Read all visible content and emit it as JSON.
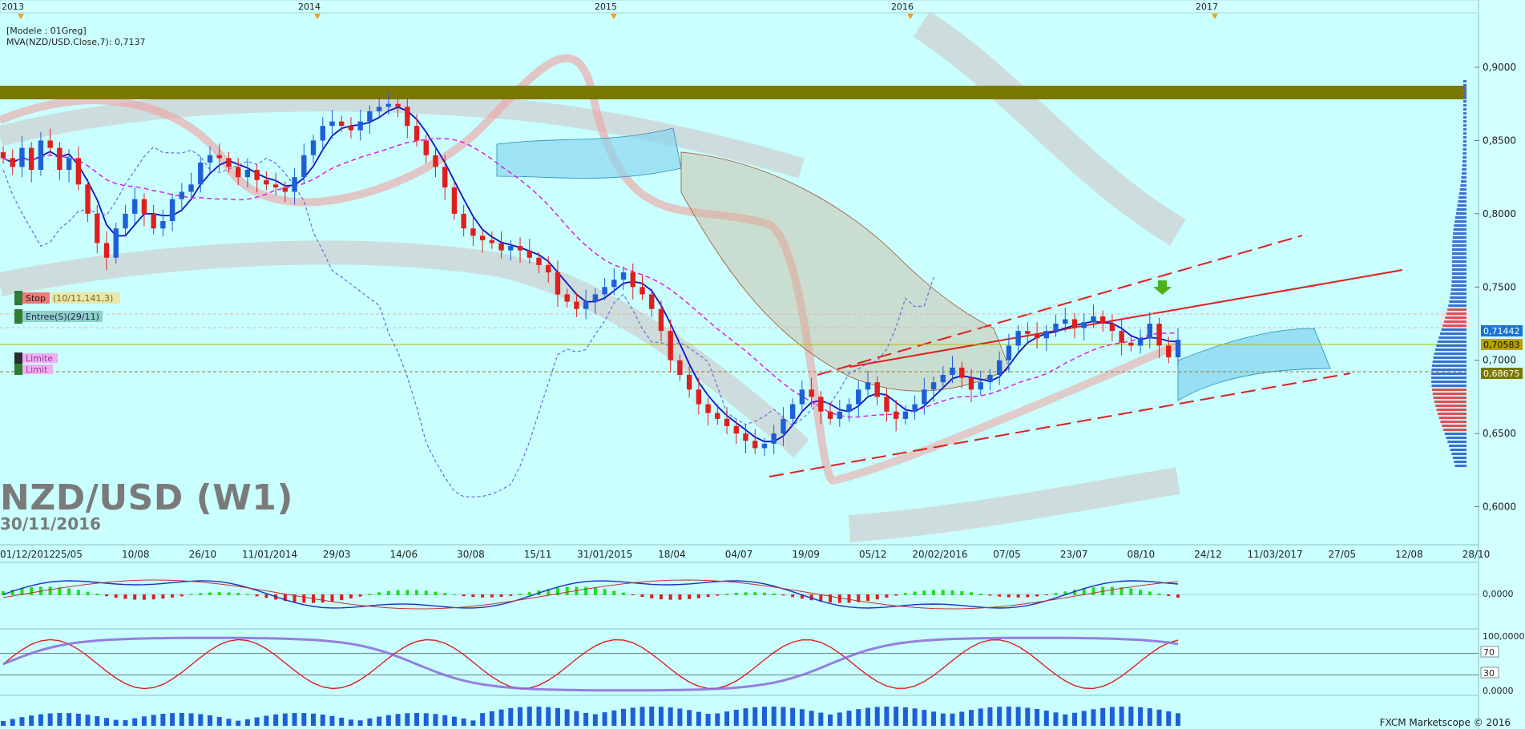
{
  "header": {
    "model": "[Modele : 01Greg]",
    "indicator": "MVA(NZD/USD.Close,7): 0,7137"
  },
  "title": {
    "symbol": "NZD/USD (W1)",
    "date": "30/11/2016"
  },
  "footer": {
    "credit": "FXCM Marketscope © 2016"
  },
  "years": [
    "2013",
    "2014",
    "2015",
    "2016",
    "2017"
  ],
  "colors": {
    "background": "#c9ffff",
    "bull": "#1f5fd6",
    "bear": "#e01e1e",
    "resistance_band": "#7a7800",
    "cloud": "#86d4ee",
    "kumo": "#c9b597"
  },
  "orders": {
    "stop_label": "Stop",
    "stop_value": "(10/11,141,3)",
    "entry_label": "Entree(S)(29/11)",
    "limit_label": "Limite",
    "limit_label2": "Limit"
  },
  "price_tags": [
    "0,71442",
    "0,70583",
    "0,68675"
  ],
  "chart_data": [
    {
      "type": "candlestick",
      "title": "NZD/USD (W1)",
      "date": "30/11/2016",
      "x_tick_labels": [
        "01/12/2012",
        "25/05",
        "10/08",
        "26/10",
        "11/01/2014",
        "29/03",
        "14/06",
        "30/08",
        "15/11",
        "31/01/2015",
        "18/04",
        "04/07",
        "19/09",
        "05/12",
        "20/02/2016",
        "07/05",
        "23/07",
        "08/10",
        "24/12",
        "11/03/2017",
        "27/05",
        "12/08",
        "28/10"
      ],
      "y_tick_labels": [
        "0,9000",
        "0,8500",
        "0,8000",
        "0,7500",
        "0,7000",
        "0,6500",
        "0,6000"
      ],
      "ylim": [
        0.585,
        0.935
      ],
      "grid": false,
      "current_price": 0.7137,
      "levels": {
        "blue_tag": 0.71442,
        "yellow_tag": 0.70583,
        "olive_tag": 0.68675,
        "resistance_band": [
          0.872,
          0.882
        ]
      },
      "close_series": [
        0.838,
        0.832,
        0.845,
        0.83,
        0.85,
        0.845,
        0.83,
        0.838,
        0.82,
        0.8,
        0.78,
        0.77,
        0.79,
        0.8,
        0.81,
        0.8,
        0.79,
        0.795,
        0.81,
        0.815,
        0.82,
        0.835,
        0.84,
        0.838,
        0.832,
        0.825,
        0.83,
        0.823,
        0.82,
        0.818,
        0.815,
        0.825,
        0.84,
        0.85,
        0.86,
        0.863,
        0.86,
        0.857,
        0.863,
        0.87,
        0.873,
        0.875,
        0.873,
        0.86,
        0.85,
        0.84,
        0.832,
        0.818,
        0.8,
        0.79,
        0.785,
        0.782,
        0.78,
        0.775,
        0.778,
        0.775,
        0.77,
        0.765,
        0.76,
        0.745,
        0.74,
        0.735,
        0.74,
        0.745,
        0.75,
        0.755,
        0.76,
        0.75,
        0.745,
        0.735,
        0.72,
        0.7,
        0.69,
        0.68,
        0.67,
        0.664,
        0.66,
        0.655,
        0.65,
        0.645,
        0.64,
        0.643,
        0.65,
        0.66,
        0.67,
        0.68,
        0.675,
        0.665,
        0.66,
        0.665,
        0.67,
        0.68,
        0.685,
        0.675,
        0.665,
        0.66,
        0.665,
        0.67,
        0.68,
        0.685,
        0.69,
        0.695,
        0.688,
        0.68,
        0.685,
        0.69,
        0.7,
        0.71,
        0.72,
        0.718,
        0.715,
        0.72,
        0.725,
        0.728,
        0.722,
        0.726,
        0.73,
        0.725,
        0.72,
        0.712,
        0.71,
        0.715,
        0.725,
        0.71,
        0.702,
        0.714
      ],
      "secondary_panels": [
        {
          "name": "MACD",
          "y_tick_labels": [
            "0,0000"
          ]
        },
        {
          "name": "Stochastic",
          "y_tick_labels": [
            "100,0000",
            "70",
            "30",
            "0.0000"
          ]
        },
        {
          "name": "Volume",
          "y_tick_labels": []
        }
      ]
    }
  ]
}
